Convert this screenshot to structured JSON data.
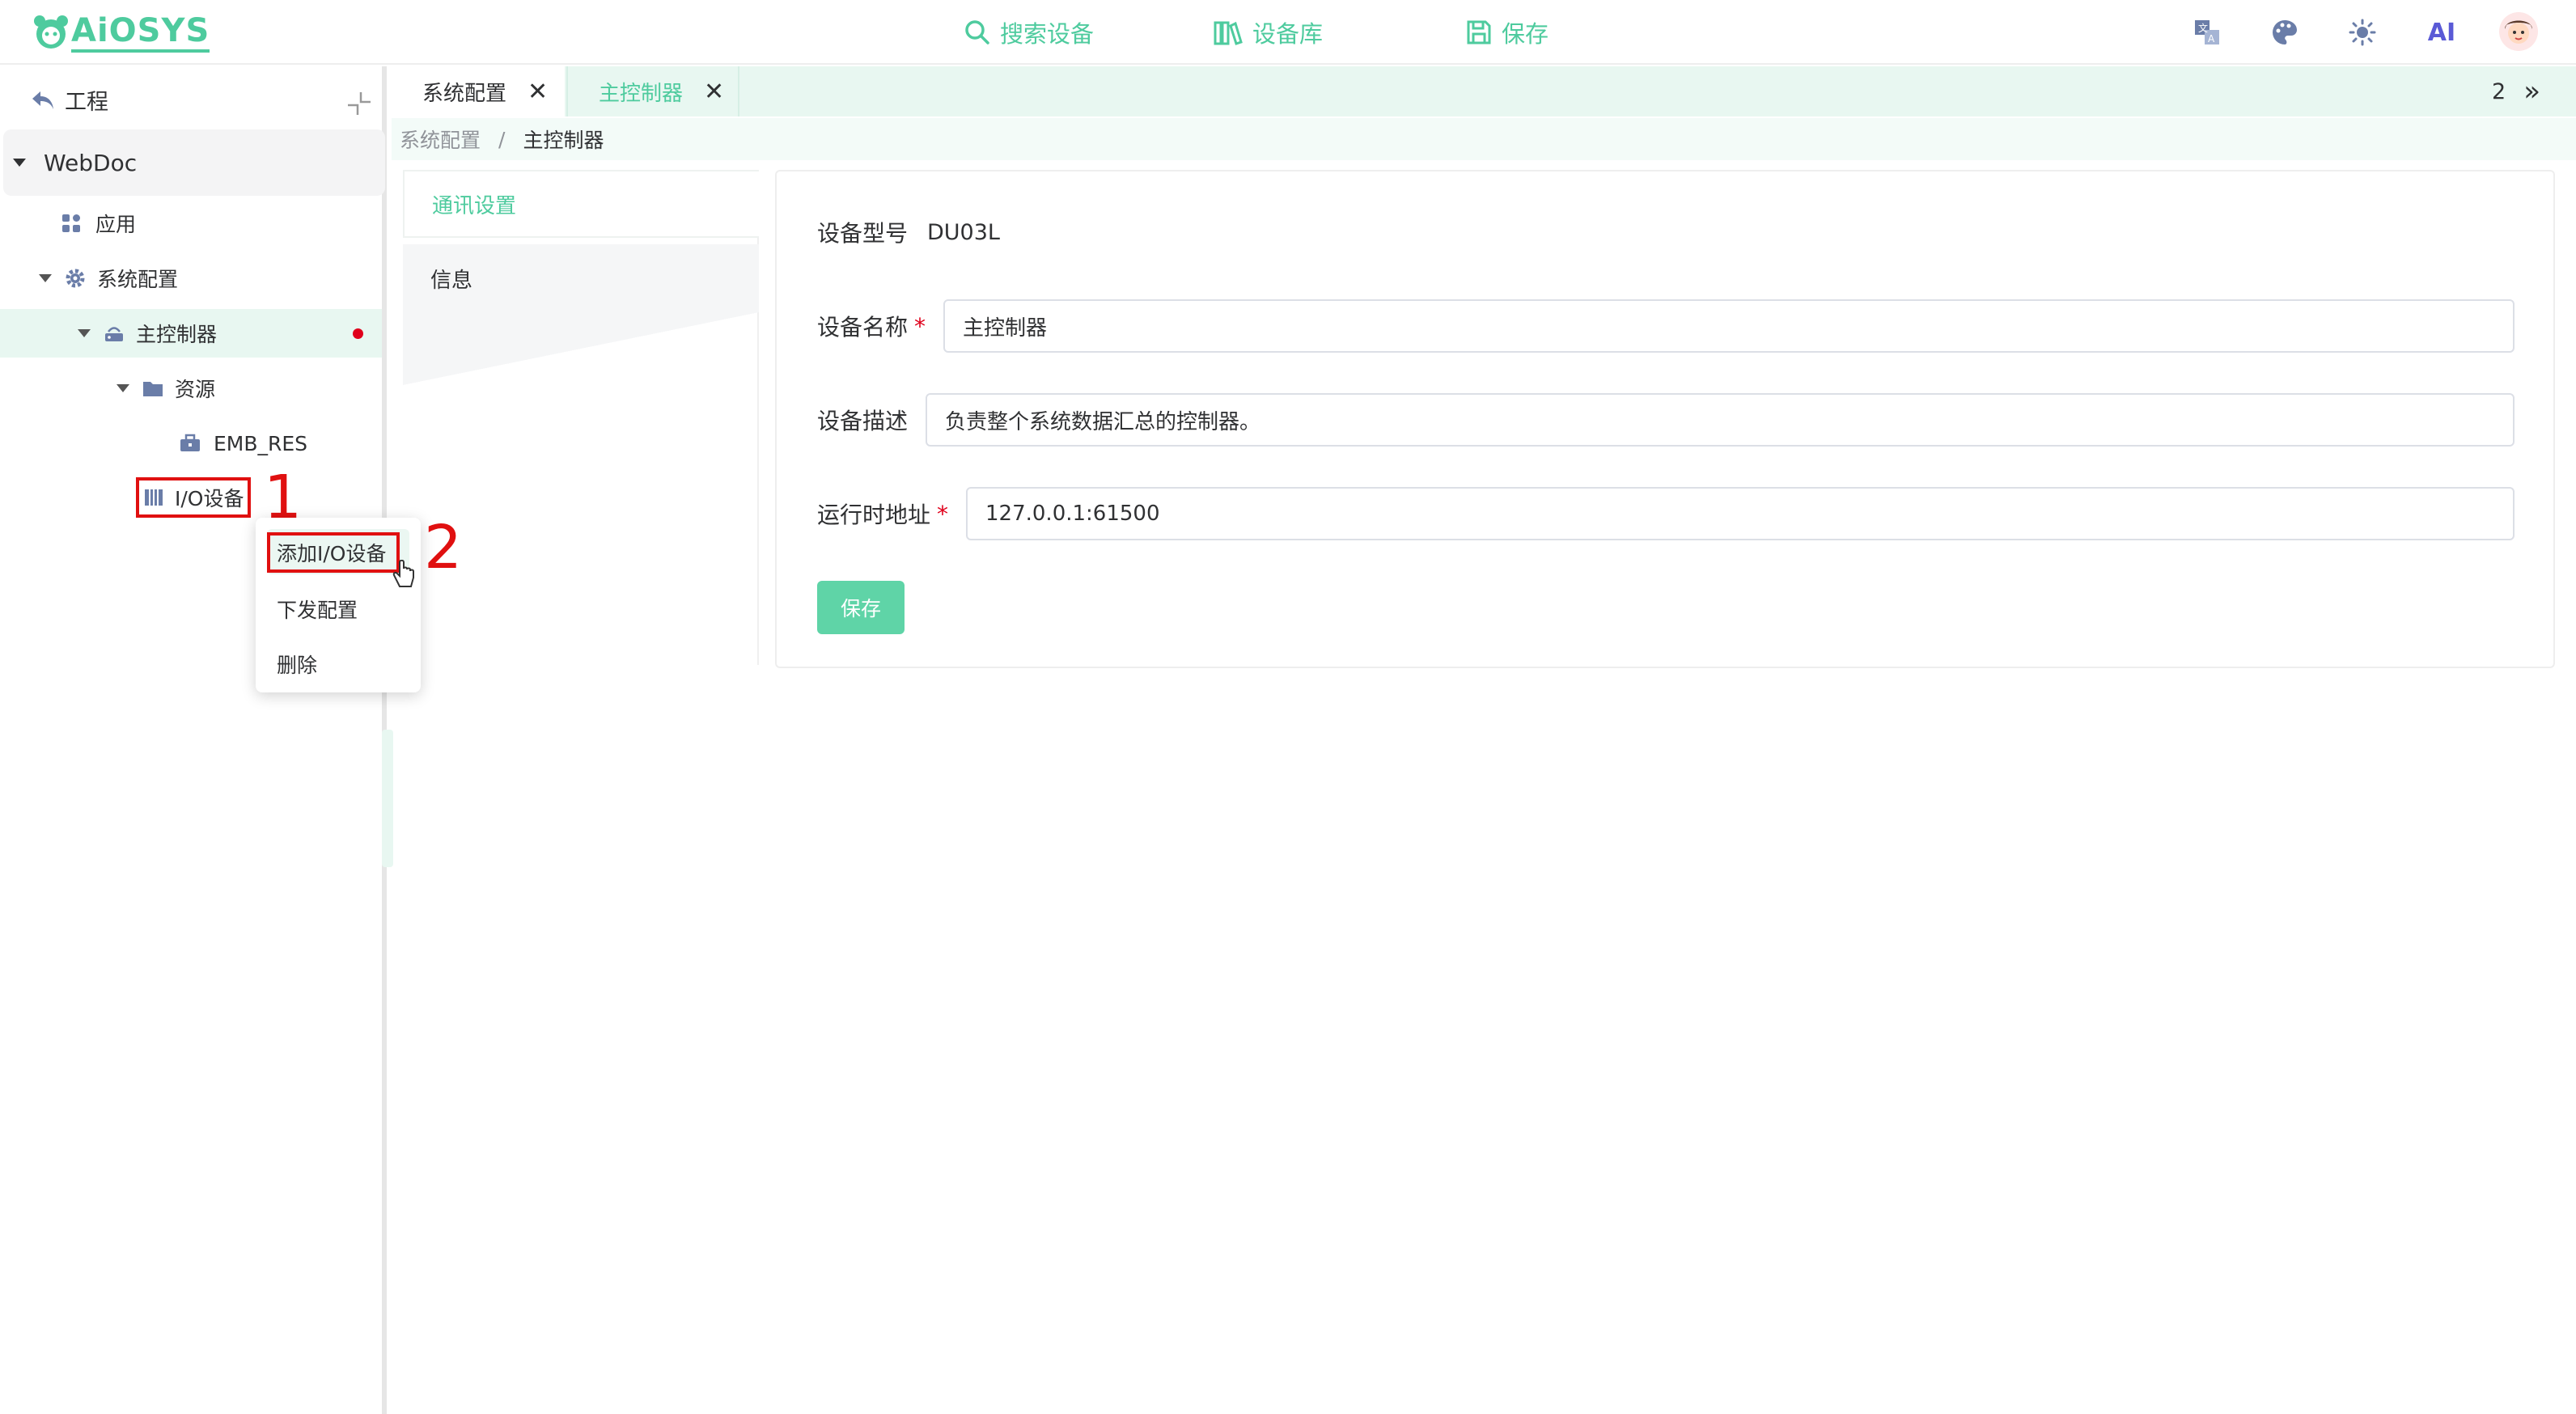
{
  "app": {
    "logo_text": "AiOSYS"
  },
  "header": {
    "nav": [
      {
        "label": "搜索设备",
        "icon": "search-icon"
      },
      {
        "label": "设备库",
        "icon": "library-icon"
      },
      {
        "label": "保存",
        "icon": "save-icon"
      }
    ],
    "ai_label": "AI"
  },
  "sidebar": {
    "project_label": "工程",
    "tree": {
      "root": "WebDoc",
      "app": "应用",
      "sys_config": "系统配置",
      "controller": "主控制器",
      "resource": "资源",
      "emb_res": "EMB_RES",
      "io_device": "I/O设备"
    }
  },
  "annotations": {
    "step1": "1",
    "step2": "2"
  },
  "context_menu": {
    "items": [
      "添加I/O设备",
      "下发配置",
      "删除"
    ]
  },
  "tabs": {
    "items": [
      {
        "label": "系统配置",
        "close": "✕"
      },
      {
        "label": "主控制器",
        "close": "✕"
      }
    ],
    "count": "2",
    "more": "»"
  },
  "breadcrumb": {
    "parent": "系统配置",
    "separator": "/",
    "current": "主控制器"
  },
  "settings_menu": {
    "items": [
      "通讯设置",
      "信息"
    ]
  },
  "form": {
    "model_label": "设备型号",
    "model_value": "DU03L",
    "name_label": "设备名称",
    "name_value": "主控制器",
    "desc_label": "设备描述",
    "desc_value": "负责整个系统数据汇总的控制器。",
    "addr_label": "运行时地址",
    "addr_value": "127.0.0.1:61500",
    "required_mark": "*",
    "save_label": "保存"
  },
  "colors": {
    "accent": "#4ecb9e",
    "selected_bg": "#e8f7f1",
    "annotation": "#e01010",
    "required": "#e0001b"
  }
}
